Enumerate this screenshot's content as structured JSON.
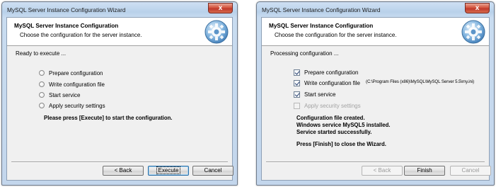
{
  "left": {
    "title": "MySQL Server Instance Configuration Wizard",
    "close_glyph": "x",
    "header_title": "MySQL Server Instance Configuration",
    "header_subtitle": "Choose the configuration for the server instance.",
    "status": "Ready to execute ...",
    "steps": [
      {
        "label": "Prepare configuration"
      },
      {
        "label": "Write configuration file"
      },
      {
        "label": "Start service"
      },
      {
        "label": "Apply security settings"
      }
    ],
    "instruction": "Please press [Execute] to start the configuration.",
    "buttons": {
      "back": "< Back",
      "execute": "Execute",
      "cancel": "Cancel"
    }
  },
  "right": {
    "title": "MySQL Server Instance Configuration Wizard",
    "close_glyph": "x",
    "header_title": "MySQL Server Instance Configuration",
    "header_subtitle": "Choose the configuration for the server instance.",
    "status": "Processing configuration ...",
    "steps": [
      {
        "label": "Prepare configuration",
        "checked": true
      },
      {
        "label": "Write configuration file",
        "checked": true
      },
      {
        "label": "Start service",
        "checked": true
      },
      {
        "label": "Apply security settings",
        "checked": false
      }
    ],
    "config_path": "(C:\\Program Files (x86)\\MySQL\\MySQL Server 5.5\\my.ini)",
    "messages": [
      "Configuration file created.",
      "Windows service MySQL5 installed.",
      "Service started successfully."
    ],
    "instruction": "Press [Finish] to close the Wizard.",
    "buttons": {
      "back": "< Back",
      "finish": "Finish",
      "cancel": "Cancel"
    }
  },
  "colors": {
    "title_bar": "#b9d1ea",
    "close_button": "#c0392b",
    "dialog_bg": "#f0f0f0"
  }
}
